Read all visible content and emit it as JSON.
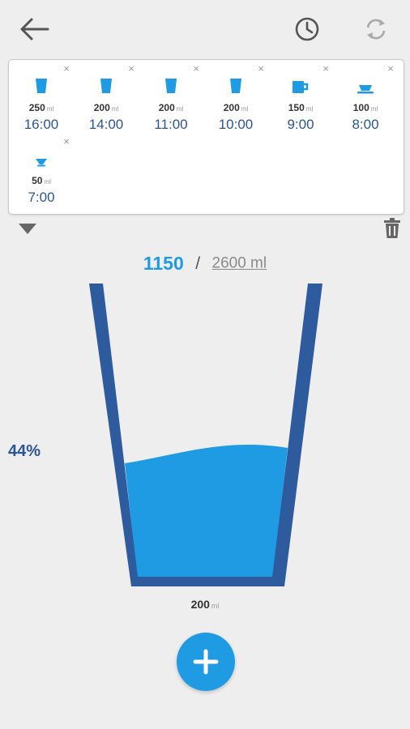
{
  "log": {
    "unit": "ml",
    "entries": [
      {
        "amount": "250",
        "time": "16:00",
        "icon": "glass-icon"
      },
      {
        "amount": "200",
        "time": "14:00",
        "icon": "glass-icon"
      },
      {
        "amount": "200",
        "time": "11:00",
        "icon": "glass-icon"
      },
      {
        "amount": "200",
        "time": "10:00",
        "icon": "glass-icon"
      },
      {
        "amount": "150",
        "time": "9:00",
        "icon": "mug-icon"
      },
      {
        "amount": "100",
        "time": "8:00",
        "icon": "cup-icon"
      },
      {
        "amount": "50",
        "time": "7:00",
        "icon": "small-cup-icon"
      }
    ],
    "remove_symbol": "×"
  },
  "progress": {
    "current": "1150",
    "separator": "/",
    "goal": "2600 ml",
    "percent_label": "44%",
    "fill_fraction": 0.44
  },
  "selected": {
    "amount": "200",
    "unit": "ml"
  },
  "colors": {
    "accent": "#1e9be3",
    "dark_blue": "#2a5599",
    "glass": "#2e5b9e"
  }
}
